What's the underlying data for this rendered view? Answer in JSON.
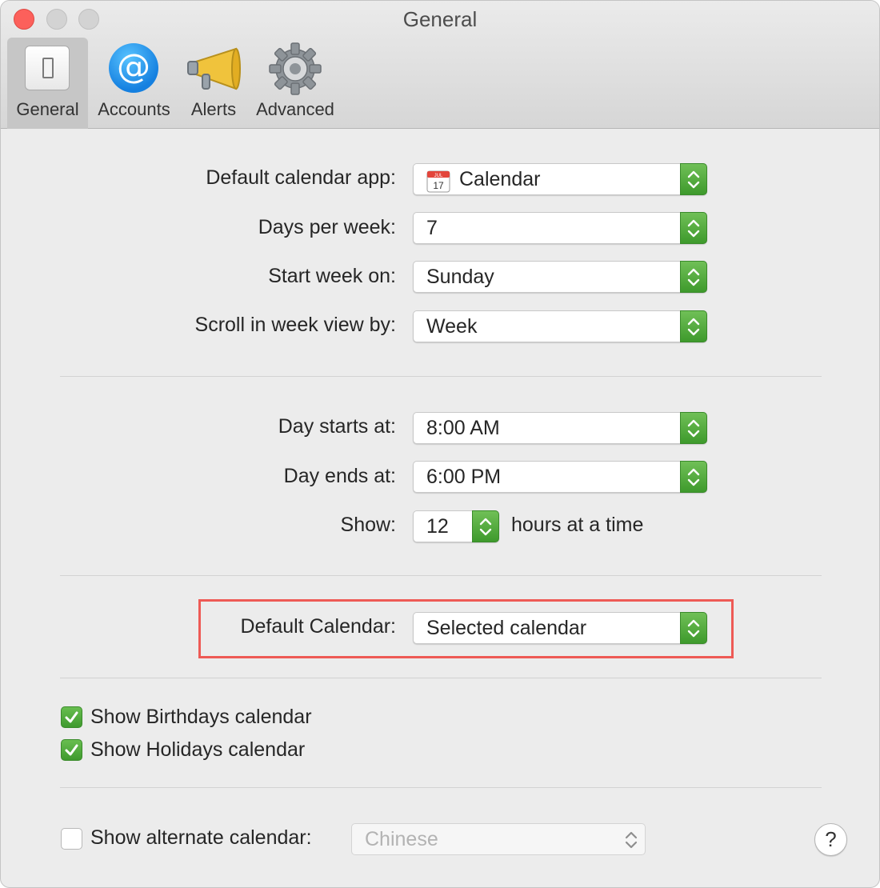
{
  "window": {
    "title": "General"
  },
  "toolbar": {
    "tabs": [
      {
        "label": "General",
        "icon": "light-switch-icon",
        "selected": true
      },
      {
        "label": "Accounts",
        "icon": "at-sign-icon",
        "selected": false
      },
      {
        "label": "Alerts",
        "icon": "megaphone-icon",
        "selected": false
      },
      {
        "label": "Advanced",
        "icon": "gear-icon",
        "selected": false
      }
    ],
    "accounts_glyph": "@"
  },
  "form": {
    "default_calendar_app": {
      "label": "Default calendar app:",
      "value": "Calendar",
      "icon": "calendar-app-icon"
    },
    "days_per_week": {
      "label": "Days per week:",
      "value": "7"
    },
    "start_week_on": {
      "label": "Start week on:",
      "value": "Sunday"
    },
    "scroll_week_view": {
      "label": "Scroll in week view by:",
      "value": "Week"
    },
    "day_starts": {
      "label": "Day starts at:",
      "value": "8:00 AM"
    },
    "day_ends": {
      "label": "Day ends at:",
      "value": "6:00 PM"
    },
    "show_hours": {
      "label": "Show:",
      "value": "12",
      "suffix": "hours at a time"
    },
    "default_calendar": {
      "label": "Default Calendar:",
      "value": "Selected calendar"
    }
  },
  "checkboxes": {
    "birthdays": {
      "label": "Show Birthdays calendar",
      "checked": true
    },
    "holidays": {
      "label": "Show Holidays calendar",
      "checked": true
    },
    "alternate": {
      "label": "Show alternate calendar:",
      "checked": false,
      "value": "Chinese"
    }
  },
  "help": {
    "glyph": "?"
  },
  "calendar_icon": {
    "month": "JUL",
    "day": "17"
  },
  "colors": {
    "accent_green": "#4caf3a",
    "highlight": "#ee5a55",
    "close": "#fc605b"
  }
}
